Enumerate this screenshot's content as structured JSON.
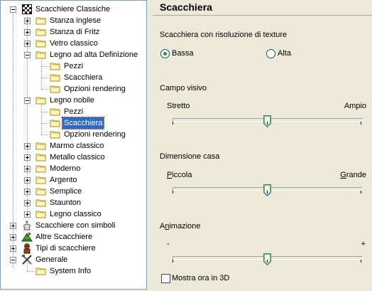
{
  "tree": {
    "root": {
      "label": "Scacchiere Classiche",
      "icon": "chessboard-icon"
    },
    "classic_items": [
      {
        "label": "Stanza inglese"
      },
      {
        "label": "Stanza di Fritz"
      },
      {
        "label": "Vetro classico"
      },
      {
        "label": "Legno ad alta Definizione",
        "children": [
          "Pezzi",
          "Scacchiera",
          "Opzioni rendering"
        ]
      },
      {
        "label": "Legno nobile",
        "children": [
          "Pezzi",
          "Scacchiera",
          "Opzioni rendering"
        ]
      },
      {
        "label": "Marmo classico"
      },
      {
        "label": "Metallo classico"
      },
      {
        "label": "Moderno"
      },
      {
        "label": "Argento"
      },
      {
        "label": "Semplice"
      },
      {
        "label": "Staunton"
      },
      {
        "label": "Legno classico"
      }
    ],
    "other_roots": [
      {
        "label": "Scacchiere con simboli",
        "icon": "chess-king-icon"
      },
      {
        "label": "Altre Scacchiere",
        "icon": "board-3d-icon"
      },
      {
        "label": "Tipi di scacchiere",
        "icon": "board-types-icon"
      },
      {
        "label": "Generale",
        "icon": "tools-icon",
        "children": [
          "System Info"
        ]
      }
    ],
    "selected": "Legno nobile / Scacchiera"
  },
  "panel": {
    "title": "Scacchiera",
    "texture_label": "Scacchiera con risoluzione di texture",
    "radio_low": "Bassa",
    "radio_high": "Alta",
    "texture_selected": "Bassa",
    "fov_label": "Campo visivo",
    "fov_min": "Stretto",
    "fov_max": "Ampio",
    "fov_value": 0.5,
    "square_label": "Dimensione casa",
    "square_min_first": "P",
    "square_min_rest": "iccola",
    "square_max_first": "G",
    "square_max_rest": "rande",
    "square_value": 0.5,
    "anim_label_pre": "A",
    "anim_label_u": "n",
    "anim_label_post": "imazione",
    "anim_min": "-",
    "anim_max": "+",
    "anim_value": 0.5,
    "show3d_label": "Mostra ora in 3D",
    "show3d_checked": false
  },
  "colors": {
    "selection": "#316ac5",
    "radio_dot": "#21a121",
    "background": "#ece9d8"
  }
}
